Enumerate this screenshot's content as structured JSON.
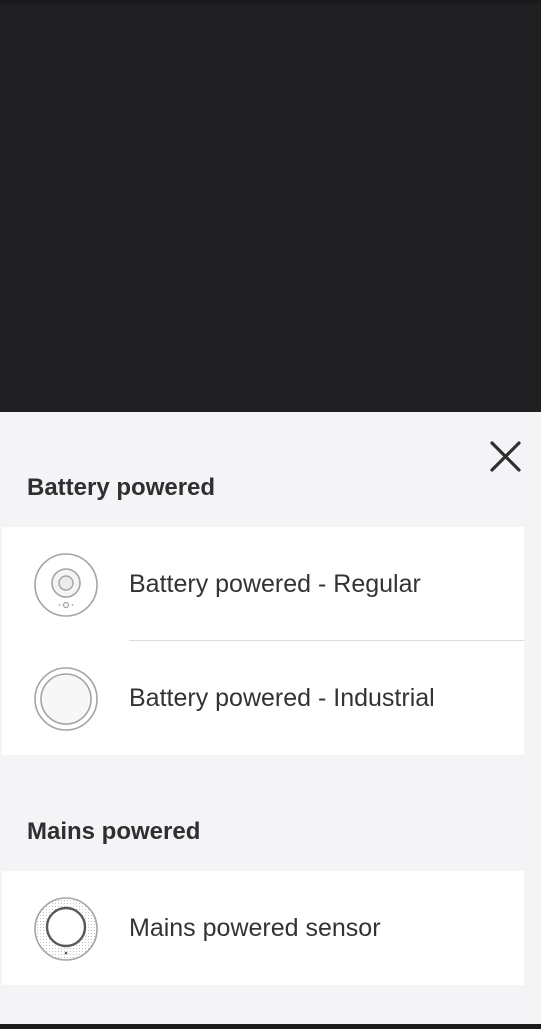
{
  "sheet": {
    "close_icon": "close-icon"
  },
  "sections": [
    {
      "title": "Battery powered",
      "items": [
        {
          "label": "Battery powered - Regular",
          "icon": "sensor-regular-icon"
        },
        {
          "label": "Battery powered - Industrial",
          "icon": "sensor-industrial-icon"
        }
      ]
    },
    {
      "title": "Mains powered",
      "items": [
        {
          "label": "Mains powered sensor",
          "icon": "sensor-mains-icon"
        }
      ]
    }
  ],
  "colors": {
    "backdrop": "#202022",
    "sheet": "#f4f4f6",
    "card": "#ffffff",
    "text": "#333336"
  }
}
